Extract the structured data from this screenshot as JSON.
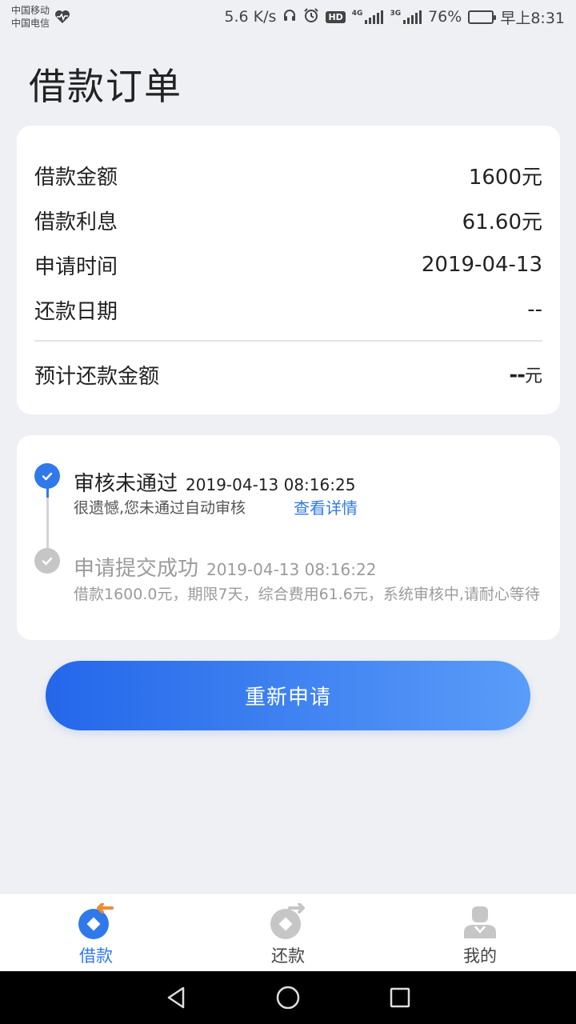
{
  "status_bar": {
    "carrier1": "中国移动",
    "carrier2": "中国电信",
    "speed": "5.6 K/s",
    "hd": "HD",
    "net1": "4G",
    "net2": "3G",
    "battery": "76%",
    "battery_level": 0.76,
    "time": "早上8:31"
  },
  "page": {
    "title": "借款订单"
  },
  "summary": {
    "amount_label": "借款金额",
    "amount_value": "1600元",
    "interest_label": "借款利息",
    "interest_value": "61.60元",
    "apply_time_label": "申请时间",
    "apply_time_value": "2019-04-13",
    "repay_date_label": "还款日期",
    "repay_date_value": "--",
    "expected_label": "预计还款金额",
    "expected_value": "--",
    "expected_unit": "元"
  },
  "timeline": {
    "step1": {
      "title": "审核未通过",
      "time": "2019-04-13 08:16:25",
      "desc": "很遗憾,您未通过自动审核",
      "link": "查看详情"
    },
    "step2": {
      "title": "申请提交成功",
      "time": "2019-04-13 08:16:22",
      "desc": "借款1600.0元，期限7天，综合费用61.6元，系统审核中,请耐心等待"
    }
  },
  "actions": {
    "reapply": "重新申请"
  },
  "tabbar": {
    "tabs": [
      {
        "label": "借款",
        "icon": "loan-icon",
        "active": true
      },
      {
        "label": "还款",
        "icon": "repay-icon",
        "active": false
      },
      {
        "label": "我的",
        "icon": "profile-icon",
        "active": false
      }
    ]
  },
  "colors": {
    "accent": "#2f79ea",
    "muted": "#c6c6c6",
    "orange": "#f08a33",
    "background": "#eef0f4"
  }
}
